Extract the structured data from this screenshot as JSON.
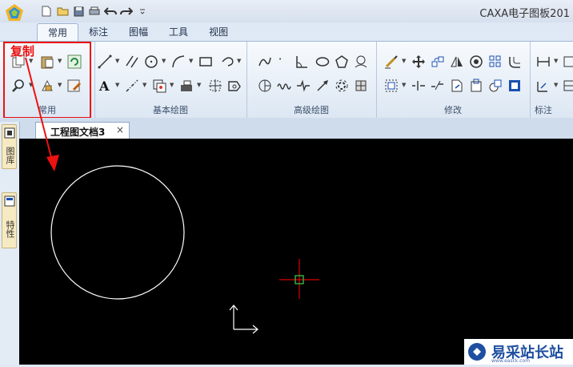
{
  "window": {
    "title": "CAXA电子图板201"
  },
  "ribbon_tabs": [
    "常用",
    "标注",
    "图幅",
    "工具",
    "视图"
  ],
  "groups": {
    "common": "常用",
    "basic_draw": "基本绘图",
    "advanced_draw": "高级绘图",
    "modify": "修改",
    "annotate": "标注"
  },
  "annotation": {
    "copy_label": "复制"
  },
  "document": {
    "tab_title": "工程图文档3",
    "close_symbol": "×"
  },
  "side_panel": {
    "tab1": "图库",
    "tab2": "特性"
  },
  "watermark": {
    "text": "易采站长站",
    "sub": "www.easck.com"
  },
  "colors": {
    "highlight": "#e11111",
    "canvas": "#000000",
    "cursor": "#dd0000",
    "cursor_box": "#39b54a",
    "geometry": "#ffffff"
  }
}
